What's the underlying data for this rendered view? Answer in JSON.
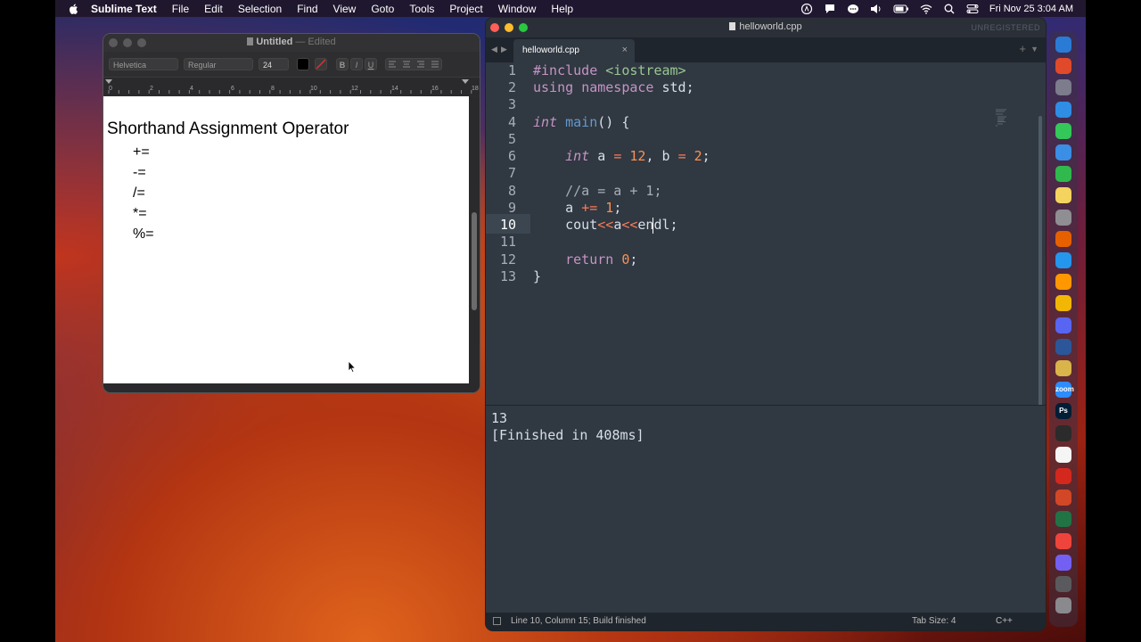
{
  "menubar": {
    "app_name": "Sublime Text",
    "items": [
      "File",
      "Edit",
      "Selection",
      "Find",
      "View",
      "Goto",
      "Tools",
      "Project",
      "Window",
      "Help"
    ],
    "datetime": "Fri Nov 25  3:04 AM",
    "status_icons": [
      "app-store-icon",
      "notification-icon",
      "messages-icon",
      "volume-icon",
      "battery-icon",
      "wifi-icon",
      "search-icon",
      "control-center-icon"
    ]
  },
  "textedit": {
    "title": "Untitled",
    "title_suffix": "— Edited",
    "toolbar": {
      "font_family": "Helvetica",
      "font_style": "Regular",
      "font_size": "24",
      "bold": "B",
      "italic": "I",
      "underline": "U"
    },
    "ruler_labels": [
      "0",
      "2",
      "4",
      "6",
      "8",
      "10",
      "12",
      "14",
      "16",
      "18"
    ],
    "document": {
      "heading": "Shorthand Assignment Operator",
      "operators": [
        "+=",
        "-=",
        "/=",
        "*=",
        "%="
      ]
    }
  },
  "sublime": {
    "window_title": "helloworld.cpp",
    "unregistered": "UNREGISTERED",
    "tab": {
      "label": "helloworld.cpp",
      "close": "×"
    },
    "line_numbers": [
      "1",
      "2",
      "3",
      "4",
      "5",
      "6",
      "7",
      "8",
      "9",
      "10",
      "11",
      "12",
      "13"
    ],
    "active_line": 10,
    "code": {
      "l1_directive": "#include",
      "l1_header": "<iostream>",
      "l2_using": "using",
      "l2_namespace": "namespace",
      "l2_rest": " std;",
      "l4_type": "int",
      "l4_func": "main",
      "l4_rest": "() {",
      "l6_type": "int",
      "l6_a": " a ",
      "l6_eq1": "=",
      "l6_12": "12",
      "l6_mid": ", b ",
      "l6_eq2": "=",
      "l6_2": "2",
      "l6_end": ";",
      "l8_comment": "//a = a + 1;",
      "l9_a": "a ",
      "l9_op": "+=",
      "l9_sp": " ",
      "l9_1": "1",
      "l9_end": ";",
      "l10_cout": "cout",
      "l10_op1": "<<",
      "l10_a": "a",
      "l10_op2": "<<",
      "l10_endl": "endl;",
      "l12_return": "return",
      "l12_sp": " ",
      "l12_0": "0",
      "l12_end": ";",
      "l13_brace": "}"
    },
    "output": {
      "result": "13",
      "finished": "[Finished in 408ms]"
    },
    "status": {
      "position": "Line 10, Column 15; Build finished",
      "tab_size": "Tab Size: 4",
      "syntax": "C++"
    }
  },
  "dock": {
    "apps": [
      {
        "name": "finder",
        "color": "#2a7bd5",
        "glyph": ""
      },
      {
        "name": "brave",
        "color": "#e04a2a",
        "glyph": ""
      },
      {
        "name": "launchpad",
        "color": "#7c7c8c",
        "glyph": ""
      },
      {
        "name": "safari",
        "color": "#2f8de4",
        "glyph": ""
      },
      {
        "name": "messages",
        "color": "#34c759",
        "glyph": ""
      },
      {
        "name": "mail",
        "color": "#3a8ee6",
        "glyph": ""
      },
      {
        "name": "facetime",
        "color": "#30b94d",
        "glyph": ""
      },
      {
        "name": "notes",
        "color": "#f4d35e",
        "glyph": ""
      },
      {
        "name": "system-settings",
        "color": "#8e8e93",
        "glyph": ""
      },
      {
        "name": "firefox",
        "color": "#e66000",
        "glyph": ""
      },
      {
        "name": "docker",
        "color": "#2496ed",
        "glyph": ""
      },
      {
        "name": "sublime",
        "color": "#ff9800",
        "glyph": ""
      },
      {
        "name": "cyberduck",
        "color": "#f2b705",
        "glyph": ""
      },
      {
        "name": "discord",
        "color": "#5865f2",
        "glyph": ""
      },
      {
        "name": "word",
        "color": "#2b579a",
        "glyph": ""
      },
      {
        "name": "reeder",
        "color": "#d9b44a",
        "glyph": ""
      },
      {
        "name": "zoom",
        "color": "#2d8cff",
        "glyph": "zoom"
      },
      {
        "name": "photoshop",
        "color": "#001e36",
        "glyph": "Ps"
      },
      {
        "name": "terminal",
        "color": "#2b2b2b",
        "glyph": ""
      },
      {
        "name": "textedit",
        "color": "#f5f5f5",
        "glyph": ""
      },
      {
        "name": "acrobat",
        "color": "#d4281e",
        "glyph": ""
      },
      {
        "name": "powerpoint",
        "color": "#d24726",
        "glyph": ""
      },
      {
        "name": "excel",
        "color": "#217346",
        "glyph": ""
      },
      {
        "name": "anydesk",
        "color": "#ef443b",
        "glyph": ""
      },
      {
        "name": "viber",
        "color": "#7360f2",
        "glyph": ""
      },
      {
        "name": "time-machine",
        "color": "#5a5a5e",
        "glyph": ""
      },
      {
        "name": "trash",
        "color": "#8a8a8e",
        "glyph": ""
      }
    ]
  },
  "colors": {
    "sublime_bg": "#303841",
    "sublime_sidebar": "#1f252c",
    "keyword": "#c594c5",
    "function": "#6699cc",
    "number": "#f99157",
    "string": "#99c794"
  }
}
